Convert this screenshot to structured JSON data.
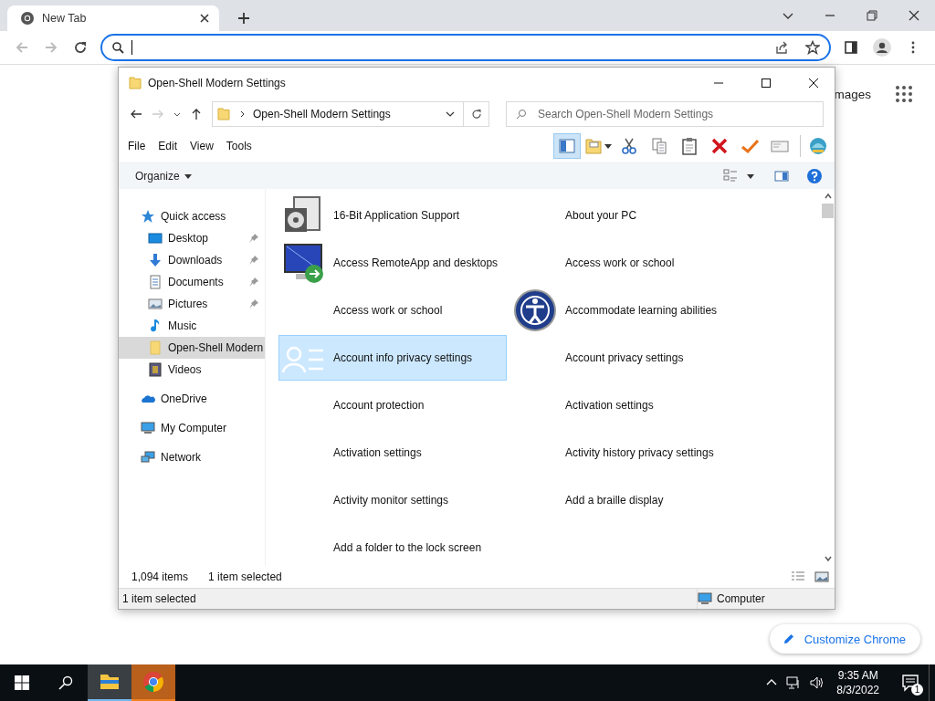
{
  "browser": {
    "tab": {
      "title": "New Tab"
    }
  },
  "page": {
    "link": "mages",
    "customize_button": "Customize Chrome"
  },
  "explorer": {
    "title": "Open-Shell Modern Settings",
    "address": "Open-Shell Modern Settings",
    "search": {
      "placeholder": "Search Open-Shell Modern Settings"
    },
    "menu": [
      "File",
      "Edit",
      "View",
      "Tools"
    ],
    "toolbar": [
      {
        "kind": "pane",
        "on": true
      },
      {
        "kind": "folder",
        "on": false
      },
      {
        "kind": "cut",
        "on": false
      },
      {
        "kind": "copy",
        "on": false
      },
      {
        "kind": "paste",
        "on": false
      },
      {
        "kind": "delete",
        "on": false
      },
      {
        "kind": "check",
        "on": false
      },
      {
        "kind": "card",
        "on": false
      },
      {
        "kind": "shell",
        "on": false
      }
    ],
    "organize": "Organize",
    "sidebar": [
      {
        "label": "Quick access",
        "kind": "star",
        "selected": false,
        "children": [
          {
            "label": "Desktop",
            "kind": "desktop",
            "pinned": true,
            "selected": false
          },
          {
            "label": "Downloads",
            "kind": "download",
            "pinned": true,
            "selected": false
          },
          {
            "label": "Documents",
            "kind": "document",
            "pinned": true,
            "selected": false
          },
          {
            "label": "Pictures",
            "kind": "picture",
            "pinned": true,
            "selected": false
          },
          {
            "label": "Music",
            "kind": "music",
            "pinned": false,
            "selected": false
          },
          {
            "label": "Open-Shell Modern",
            "kind": "folder",
            "pinned": false,
            "selected": true
          },
          {
            "label": "Videos",
            "kind": "video",
            "pinned": false,
            "selected": false
          }
        ]
      },
      {
        "label": "OneDrive",
        "kind": "cloud",
        "selected": false
      },
      {
        "label": "My Computer",
        "kind": "computer",
        "selected": false
      },
      {
        "label": "Network",
        "kind": "network",
        "selected": false
      }
    ],
    "items": [
      {
        "label": "16-Bit Application Support",
        "kind": "disc",
        "selected": false
      },
      {
        "label": "About your PC",
        "kind": "plain",
        "selected": false
      },
      {
        "label": "Access RemoteApp and desktops",
        "kind": "remote",
        "selected": false
      },
      {
        "label": "Access work or school",
        "kind": "plain",
        "selected": false
      },
      {
        "label": "Access work or school",
        "kind": "plain",
        "selected": false
      },
      {
        "label": "Accommodate learning abilities",
        "kind": "accessibility",
        "selected": false
      },
      {
        "label": "Account info privacy settings",
        "kind": "account",
        "selected": true
      },
      {
        "label": "Account privacy settings",
        "kind": "plain",
        "selected": false
      },
      {
        "label": "Account protection",
        "kind": "plain",
        "selected": false
      },
      {
        "label": "Activation settings",
        "kind": "plain",
        "selected": false
      },
      {
        "label": "Activation settings",
        "kind": "plain",
        "selected": false
      },
      {
        "label": "Activity history privacy settings",
        "kind": "plain",
        "selected": false
      },
      {
        "label": "Activity monitor settings",
        "kind": "plain",
        "selected": false
      },
      {
        "label": "Add a braille display",
        "kind": "plain",
        "selected": false
      },
      {
        "label": "Add a folder to the lock screen",
        "kind": "plain",
        "selected": false
      }
    ],
    "status": {
      "count": "1,094 items",
      "selection": "1 item selected"
    },
    "status_bar": {
      "text": "1 item selected",
      "location": "Computer"
    }
  },
  "taskbar": {
    "apps": [
      {
        "kind": "explorer",
        "active": true,
        "flashing": false
      },
      {
        "kind": "chrome",
        "active": false,
        "flashing": true
      }
    ],
    "time": "9:35 AM",
    "date": "8/3/2022",
    "notifications": "1"
  }
}
